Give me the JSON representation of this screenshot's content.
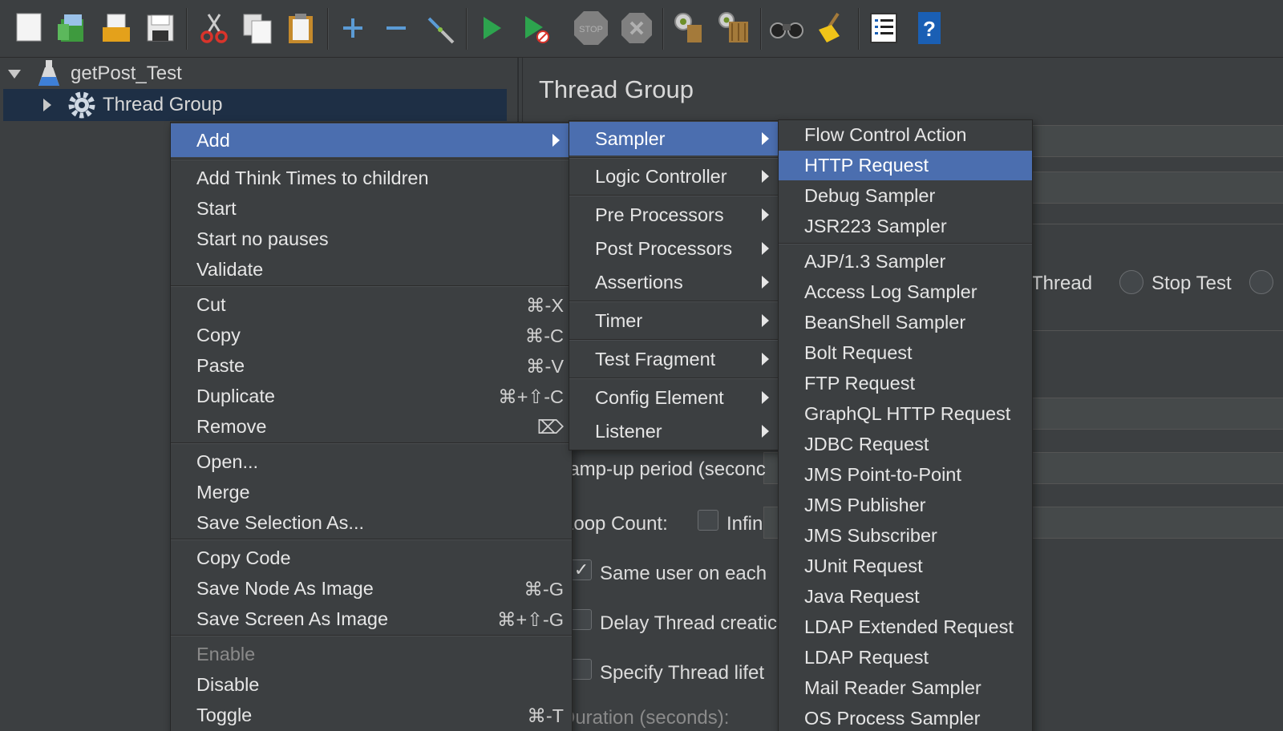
{
  "toolbar": {
    "icons": [
      "new-icon",
      "templates-icon",
      "open-icon",
      "save-icon",
      "cut-icon",
      "copy-icon",
      "paste-icon",
      "expand-icon",
      "collapse-icon",
      "toggle-icon",
      "start-icon",
      "start-no-pauses-icon",
      "stop-icon",
      "shutdown-icon",
      "clear-icon",
      "clear-all-icon",
      "search-icon",
      "reset-search-icon",
      "function-helper-icon",
      "help-icon"
    ]
  },
  "tree": {
    "root_label": "getPost_Test",
    "thread_group_label": "Thread Group"
  },
  "panel": {
    "title": "Thread Group",
    "stop_thread_partial": "Thread",
    "stop_test": "Stop Test",
    "rampup_label": "Ramp-up period (seconc",
    "loop_count_label": "Loop Count:",
    "infinite_partial": "Infin",
    "same_user_label": "Same user on each",
    "delay_thread_label": "Delay Thread creatic",
    "specify_lifetime_label": "Specify Thread lifet",
    "duration_partial": "Duration (seconds):"
  },
  "context_menu": {
    "add": "Add",
    "add_think_times": "Add Think Times to children",
    "start": "Start",
    "start_no_pauses": "Start no pauses",
    "validate": "Validate",
    "cut": "Cut",
    "cut_sc": "⌘-X",
    "copy": "Copy",
    "copy_sc": "⌘-C",
    "paste": "Paste",
    "paste_sc": "⌘-V",
    "duplicate": "Duplicate",
    "duplicate_sc": "⌘+⇧-C",
    "remove": "Remove",
    "remove_sc": "⌦",
    "open": "Open...",
    "merge": "Merge",
    "save_selection": "Save Selection As...",
    "copy_code": "Copy Code",
    "save_node_image": "Save Node As Image",
    "save_node_image_sc": "⌘-G",
    "save_screen_image": "Save Screen As Image",
    "save_screen_image_sc": "⌘+⇧-G",
    "enable": "Enable",
    "disable": "Disable",
    "toggle": "Toggle",
    "toggle_sc": "⌘-T"
  },
  "add_menu": {
    "sampler": "Sampler",
    "logic_controller": "Logic Controller",
    "pre_processors": "Pre Processors",
    "post_processors": "Post Processors",
    "assertions": "Assertions",
    "timer": "Timer",
    "test_fragment": "Test Fragment",
    "config_element": "Config Element",
    "listener": "Listener"
  },
  "sampler_menu": {
    "items": [
      "Flow Control Action",
      "HTTP Request",
      "Debug Sampler",
      "JSR223 Sampler",
      "AJP/1.3 Sampler",
      "Access Log Sampler",
      "BeanShell Sampler",
      "Bolt Request",
      "FTP Request",
      "GraphQL HTTP Request",
      "JDBC Request",
      "JMS Point-to-Point",
      "JMS Publisher",
      "JMS Subscriber",
      "JUnit Request",
      "Java Request",
      "LDAP Extended Request",
      "LDAP Request",
      "Mail Reader Sampler",
      "OS Process Sampler"
    ],
    "highlighted": "HTTP Request"
  },
  "colors": {
    "background": "#3c3f41",
    "highlight": "#4b6eaf",
    "tree_selection": "#1e2f45"
  }
}
